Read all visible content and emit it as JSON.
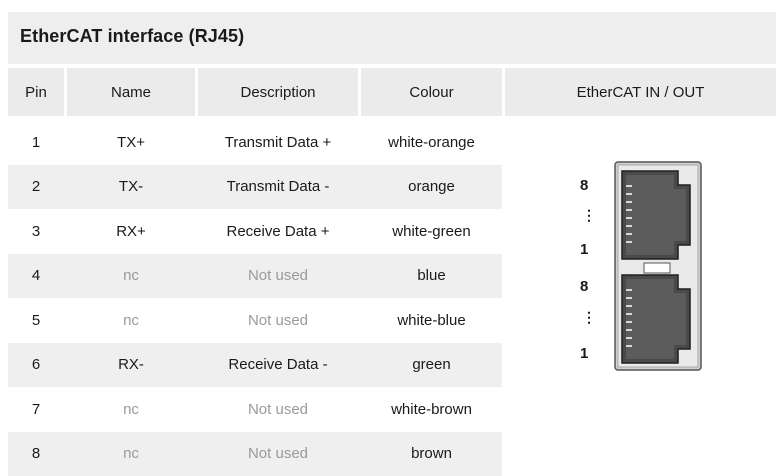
{
  "title": "EtherCAT interface (RJ45)",
  "headers": [
    "Pin",
    "Name",
    "Description",
    "Colour",
    "EtherCAT IN / OUT"
  ],
  "rows": [
    {
      "pin": "1",
      "name": "TX+",
      "description": "Transmit Data +",
      "colour": "white-orange",
      "used": true
    },
    {
      "pin": "2",
      "name": "TX-",
      "description": "Transmit Data -",
      "colour": "orange",
      "used": true
    },
    {
      "pin": "3",
      "name": "RX+",
      "description": "Receive Data +",
      "colour": "white-green",
      "used": true
    },
    {
      "pin": "4",
      "name": "nc",
      "description": "Not used",
      "colour": "blue",
      "used": false
    },
    {
      "pin": "5",
      "name": "nc",
      "description": "Not used",
      "colour": "white-blue",
      "used": false
    },
    {
      "pin": "6",
      "name": "RX-",
      "description": "Receive Data -",
      "colour": "green",
      "used": true
    },
    {
      "pin": "7",
      "name": "nc",
      "description": "Not used",
      "colour": "white-brown",
      "used": false
    },
    {
      "pin": "8",
      "name": "nc",
      "description": "Not used",
      "colour": "brown",
      "used": false
    }
  ],
  "connector": {
    "upper_top_label": "8",
    "upper_bottom_label": "1",
    "lower_top_label": "8",
    "lower_bottom_label": "1",
    "dots": "⋮",
    "icon": "rj45-double-port-icon"
  }
}
